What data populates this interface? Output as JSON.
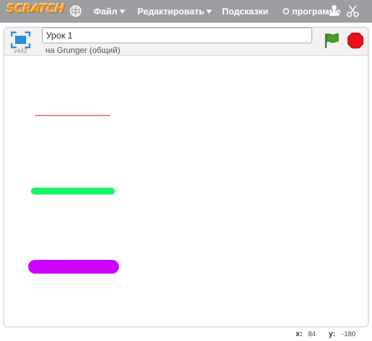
{
  "menubar": {
    "logo": "SCRATCH",
    "items": [
      {
        "label": "Файл",
        "has_caret": true
      },
      {
        "label": "Редактировать",
        "has_caret": true
      },
      {
        "label": "Подсказки",
        "has_caret": false
      },
      {
        "label": "О программе",
        "has_caret": false
      }
    ],
    "icons": [
      "globe-icon",
      "copy-stamp-icon",
      "cut-scissors-icon"
    ]
  },
  "stage_header": {
    "version": "v442",
    "project_title": "Урок 1",
    "owner_text": "на Grunger (общий)"
  },
  "stage": {
    "lines": [
      {
        "color": "#d40000",
        "thickness": "thin"
      },
      {
        "color": "#18f56a",
        "thickness": "medium"
      },
      {
        "color": "#cc00ff",
        "thickness": "thick"
      }
    ]
  },
  "status": {
    "x_label": "x:",
    "x_value": "84",
    "y_label": "y:",
    "y_value": "-180"
  },
  "colors": {
    "menubar_bg": "#9c9ea2",
    "flag_green": "#4c9a2a",
    "stop_red": "#e8101a",
    "logo_orange": "#f2a12b"
  }
}
